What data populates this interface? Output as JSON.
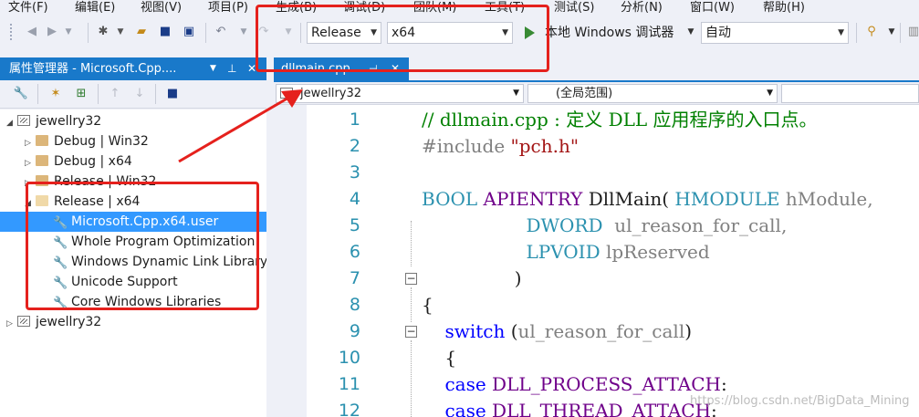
{
  "menu": [
    "文件(F)",
    "编辑(E)",
    "视图(V)",
    "项目(P)",
    "生成(B)",
    "调试(D)",
    "团队(M)",
    "工具(T)",
    "测试(S)",
    "分析(N)",
    "窗口(W)",
    "帮助(H)"
  ],
  "toolbar": {
    "config_value": "Release",
    "platform_value": "x64",
    "run_label": "本地 Windows 调试器",
    "run_mode_value": "自动"
  },
  "property_manager": {
    "title": "属性管理器 - Microsoft.Cpp....",
    "tree": [
      {
        "label": "jewellry32"
      },
      {
        "label": "Debug | Win32"
      },
      {
        "label": "Debug | x64"
      },
      {
        "label": "Release | Win32"
      },
      {
        "label": "Release | x64"
      },
      {
        "label": "Microsoft.Cpp.x64.user"
      },
      {
        "label": "Whole Program Optimization"
      },
      {
        "label": "Windows Dynamic Link Library"
      },
      {
        "label": "Unicode Support"
      },
      {
        "label": "Core Windows Libraries"
      },
      {
        "label": "jewellry32"
      }
    ]
  },
  "editor": {
    "tab_label": "dllmain.cpp",
    "nav_project": "jewellry32",
    "nav_scope": "(全局范围)",
    "lines": [
      {
        "n": "1",
        "parts": [
          {
            "t": "// dllmain.cpp : 定义 DLL 应用程序的入口点。",
            "c": "cm"
          }
        ]
      },
      {
        "n": "2",
        "parts": [
          {
            "t": "#include ",
            "c": "pp"
          },
          {
            "t": "\"pch.h\"",
            "c": "st"
          }
        ]
      },
      {
        "n": "3",
        "parts": []
      },
      {
        "n": "4",
        "parts": [
          {
            "t": "BOOL ",
            "c": "ty"
          },
          {
            "t": "APIENTRY ",
            "c": "mac"
          },
          {
            "t": "DllMain( ",
            "c": "fn"
          },
          {
            "t": "HMODULE ",
            "c": "ty"
          },
          {
            "t": "hModule,",
            "c": "pm"
          }
        ]
      },
      {
        "n": "5",
        "parts": [
          {
            "t": "                  ",
            "c": "fn"
          },
          {
            "t": "DWORD  ",
            "c": "ty"
          },
          {
            "t": "ul_reason_for_call,",
            "c": "pm"
          }
        ]
      },
      {
        "n": "6",
        "parts": [
          {
            "t": "                  ",
            "c": "fn"
          },
          {
            "t": "LPVOID ",
            "c": "ty"
          },
          {
            "t": "lpReserved",
            "c": "pm"
          }
        ]
      },
      {
        "n": "7",
        "parts": [
          {
            "t": "                )",
            "c": "fn"
          }
        ]
      },
      {
        "n": "8",
        "parts": [
          {
            "t": "{",
            "c": "fn"
          }
        ]
      },
      {
        "n": "9",
        "parts": [
          {
            "t": "    ",
            "c": "fn"
          },
          {
            "t": "switch ",
            "c": "kw"
          },
          {
            "t": "(",
            "c": "fn"
          },
          {
            "t": "ul_reason_for_call",
            "c": "pm"
          },
          {
            "t": ")",
            "c": "fn"
          }
        ]
      },
      {
        "n": "10",
        "parts": [
          {
            "t": "    {",
            "c": "fn"
          }
        ]
      },
      {
        "n": "11",
        "parts": [
          {
            "t": "    ",
            "c": "fn"
          },
          {
            "t": "case ",
            "c": "kw"
          },
          {
            "t": "DLL_PROCESS_ATTACH",
            "c": "mac"
          },
          {
            "t": ":",
            "c": "fn"
          }
        ]
      },
      {
        "n": "12",
        "parts": [
          {
            "t": "    ",
            "c": "fn"
          },
          {
            "t": "case ",
            "c": "kw"
          },
          {
            "t": "DLL_THREAD_ATTACH",
            "c": "mac"
          },
          {
            "t": ":",
            "c": "fn"
          }
        ]
      }
    ]
  },
  "watermark": "https://blog.csdn.net/BigData_Mining",
  "colors": {
    "accent": "#1979ca",
    "selection": "#3399ff",
    "annotation": "#e5211d"
  },
  "icons": [
    "back-icon",
    "forward-icon",
    "new-project-icon",
    "open-folder-icon",
    "save-icon",
    "save-all-icon",
    "undo-icon",
    "redo-icon",
    "start-debug-icon",
    "find-icon",
    "wrench-icon",
    "add-property-sheet-icon",
    "add-existing-sheet-icon",
    "move-up-icon",
    "move-down-icon",
    "pin-icon",
    "close-icon"
  ]
}
